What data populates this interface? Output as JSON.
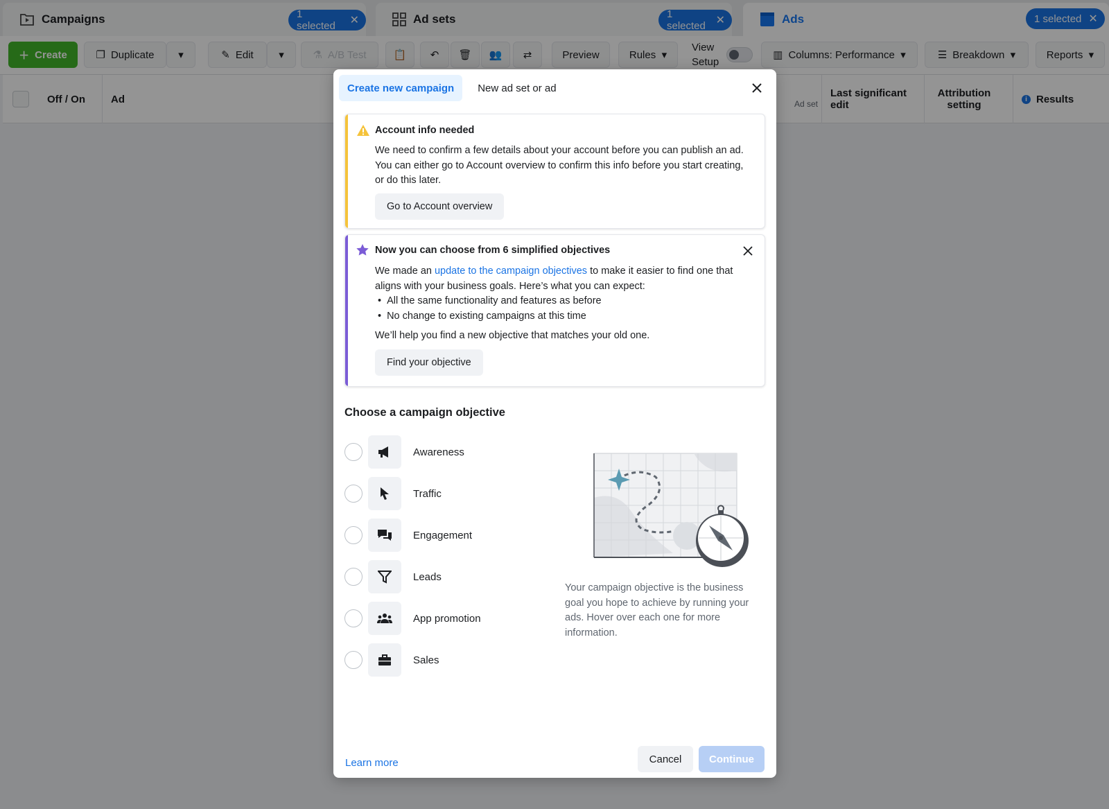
{
  "topbar": {
    "campaigns": {
      "title": "Campaigns",
      "selected": "1 selected"
    },
    "adsets": {
      "title": "Ad sets",
      "selected": "1 selected"
    },
    "ads": {
      "title": "Ads",
      "selected": "1 selected"
    }
  },
  "toolbar": {
    "create": "Create",
    "duplicate": "Duplicate",
    "edit": "Edit",
    "ab_test": "A/B Test",
    "preview": "Preview",
    "rules": "Rules",
    "view_setup_line1": "View",
    "view_setup_line2": "Setup",
    "columns": "Columns: Performance",
    "breakdown": "Breakdown",
    "reports": "Reports"
  },
  "table_header": {
    "off_on": "Off / On",
    "ad": "Ad",
    "ad_set": "Ad set",
    "last_edit": "Last significant edit",
    "attribution": "Attribution setting",
    "results": "Results"
  },
  "modal": {
    "tabs": [
      "Create new campaign",
      "New ad set or ad"
    ],
    "account_card": {
      "title": "Account info needed",
      "text": "We need to confirm a few details about your account before you can publish an ad. You can either go to Account overview to confirm this info before you start creating, or do this later.",
      "button": "Go to Account overview"
    },
    "objectives_card": {
      "title": "Now you can choose from 6 simplified objectives",
      "text_before": "We made an ",
      "link": "update to the campaign objectives",
      "text_after": " to make it easier to find one that aligns with your business goals. Here’s what you can expect:",
      "bullets": [
        "All the same functionality and features as before",
        "No change to existing campaigns at this time"
      ],
      "followup": "We’ll help you find a new objective that matches your old one.",
      "button": "Find your objective"
    },
    "section_title": "Choose a campaign objective",
    "objectives": [
      {
        "label": "Awareness",
        "icon": "megaphone-icon"
      },
      {
        "label": "Traffic",
        "icon": "cursor-icon"
      },
      {
        "label": "Engagement",
        "icon": "chat-bubbles-icon"
      },
      {
        "label": "Leads",
        "icon": "funnel-icon"
      },
      {
        "label": "App promotion",
        "icon": "people-icon"
      },
      {
        "label": "Sales",
        "icon": "briefcase-icon"
      }
    ],
    "side_description": "Your campaign objective is the business goal you hope to achieve by running your ads. Hover over each one for more information.",
    "learn_more": "Learn more",
    "cancel": "Cancel",
    "continue": "Continue"
  },
  "colors": {
    "accent": "#1b74e4",
    "warning_stripe": "#f5c33b",
    "info_stripe": "#7b5cd6",
    "create_green": "#42b72a"
  }
}
